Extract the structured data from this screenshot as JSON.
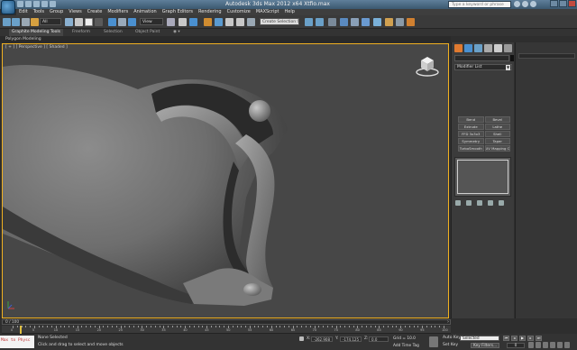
{
  "titlebar": {
    "title": "Autodesk 3ds Max 2012 x64      Xtfio.max",
    "search_placeholder": "Type a keyword or phrase"
  },
  "menu": [
    "Edit",
    "Tools",
    "Group",
    "Views",
    "Create",
    "Modifiers",
    "Animation",
    "Graph Editors",
    "Rendering",
    "Customize",
    "MAXScript",
    "Help"
  ],
  "toolbar": {
    "selection_filter": "All",
    "reference_coord": "View",
    "named_selection": "Create Selection Se"
  },
  "ribbon": {
    "tabs": [
      "Graphite Modeling Tools",
      "Freeform",
      "Selection",
      "Object Paint"
    ],
    "active_panel": "Polygon Modeling"
  },
  "viewport": {
    "label": "[ + ] [ Perspective ] [ Shaded ]"
  },
  "command_panel": {
    "modifier_list": "Modifier List",
    "buttons": [
      "Bend",
      "Bevel",
      "Extrude",
      "Lathe",
      "FFD 3x3x3",
      "Shell",
      "Symmetry",
      "Taper",
      "TurboSmooth",
      "UV Mapping Cl"
    ]
  },
  "timeline": {
    "slider_label": "0 / 100",
    "ticks": [
      "0",
      "5",
      "10",
      "15",
      "20",
      "25",
      "30",
      "35",
      "40",
      "45",
      "50",
      "55",
      "60",
      "65",
      "70",
      "75",
      "80",
      "85",
      "90",
      "95",
      "100"
    ]
  },
  "status": {
    "maxscript": "Max to Physc",
    "selection": "None Selected",
    "prompt": "Click and drag to select and move objects",
    "x_label": "X:",
    "x": "-262.908",
    "y_label": "Y:",
    "y": "-174.125",
    "z_label": "Z:",
    "z": "0.0",
    "grid": "Grid = 10.0",
    "add_time_tag": "Add Time Tag",
    "auto_key": "Auto Key",
    "set_key": "Set Key",
    "key_mode": "Selected",
    "key_filters": "Key Filters...",
    "frame": "0"
  },
  "colors": {
    "viewport_border": "#f0b020",
    "viewport_bg": "#474747",
    "panel_bg": "#3b3b3b"
  }
}
